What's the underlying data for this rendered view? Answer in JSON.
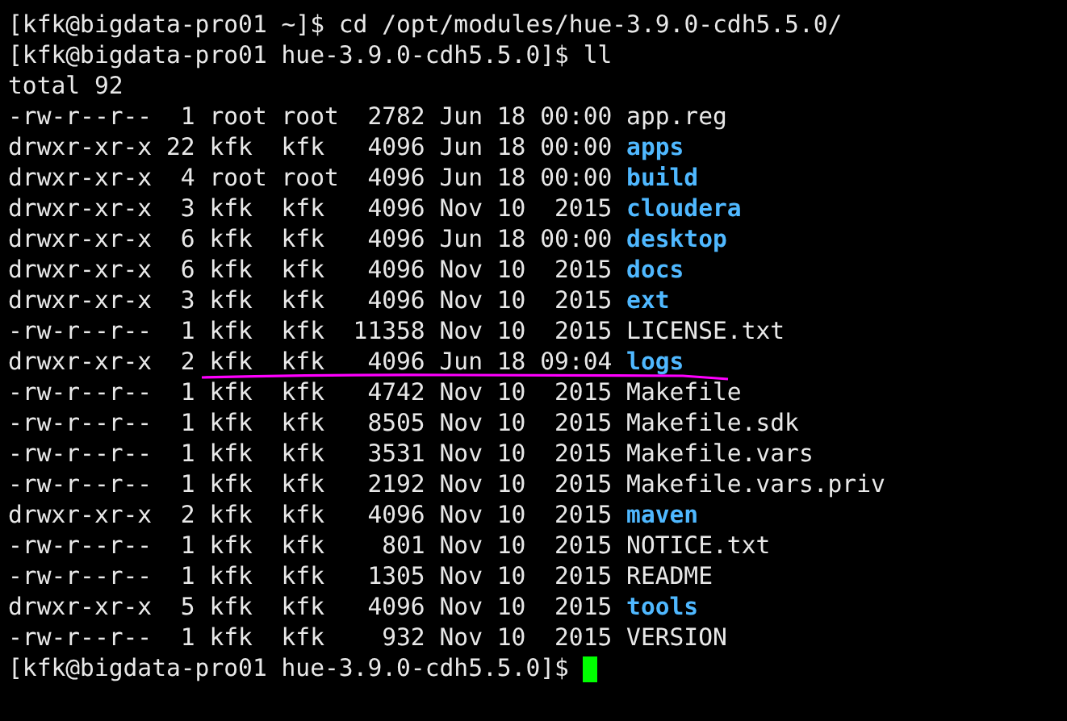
{
  "terminal": {
    "lines": [
      {
        "kind": "command",
        "prompt": "[kfk@bigdata-pro01 ~]$",
        "command": "cd /opt/modules/hue-3.9.0-cdh5.5.0/"
      },
      {
        "kind": "command",
        "prompt": "[kfk@bigdata-pro01 hue-3.9.0-cdh5.5.0]$",
        "command": "ll"
      },
      {
        "kind": "output",
        "text": "total 92"
      },
      {
        "kind": "file",
        "info": "-rw-r--r--  1 root root  2782 Jun 18 00:00",
        "name": "app.reg"
      },
      {
        "kind": "dir",
        "info": "drwxr-xr-x 22 kfk  kfk   4096 Jun 18 00:00",
        "name": "apps"
      },
      {
        "kind": "dir",
        "info": "drwxr-xr-x  4 root root  4096 Jun 18 00:00",
        "name": "build"
      },
      {
        "kind": "dir",
        "info": "drwxr-xr-x  3 kfk  kfk   4096 Nov 10  2015",
        "name": "cloudera"
      },
      {
        "kind": "dir",
        "info": "drwxr-xr-x  6 kfk  kfk   4096 Jun 18 00:00",
        "name": "desktop"
      },
      {
        "kind": "dir",
        "info": "drwxr-xr-x  6 kfk  kfk   4096 Nov 10  2015",
        "name": "docs"
      },
      {
        "kind": "dir",
        "info": "drwxr-xr-x  3 kfk  kfk   4096 Nov 10  2015",
        "name": "ext"
      },
      {
        "kind": "file",
        "info": "-rw-r--r--  1 kfk  kfk  11358 Nov 10  2015",
        "name": "LICENSE.txt"
      },
      {
        "kind": "dir",
        "info": "drwxr-xr-x  2 kfk  kfk   4096 Jun 18 09:04",
        "name": "logs",
        "underlined": true
      },
      {
        "kind": "file",
        "info": "-rw-r--r--  1 kfk  kfk   4742 Nov 10  2015",
        "name": "Makefile"
      },
      {
        "kind": "file",
        "info": "-rw-r--r--  1 kfk  kfk   8505 Nov 10  2015",
        "name": "Makefile.sdk"
      },
      {
        "kind": "file",
        "info": "-rw-r--r--  1 kfk  kfk   3531 Nov 10  2015",
        "name": "Makefile.vars"
      },
      {
        "kind": "file",
        "info": "-rw-r--r--  1 kfk  kfk   2192 Nov 10  2015",
        "name": "Makefile.vars.priv"
      },
      {
        "kind": "dir",
        "info": "drwxr-xr-x  2 kfk  kfk   4096 Nov 10  2015",
        "name": "maven"
      },
      {
        "kind": "file",
        "info": "-rw-r--r--  1 kfk  kfk    801 Nov 10  2015",
        "name": "NOTICE.txt"
      },
      {
        "kind": "file",
        "info": "-rw-r--r--  1 kfk  kfk   1305 Nov 10  2015",
        "name": "README"
      },
      {
        "kind": "dir",
        "info": "drwxr-xr-x  5 kfk  kfk   4096 Nov 10  2015",
        "name": "tools"
      },
      {
        "kind": "file",
        "info": "-rw-r--r--  1 kfk  kfk    932 Nov 10  2015",
        "name": "VERSION"
      },
      {
        "kind": "command",
        "prompt": "[kfk@bigdata-pro01 hue-3.9.0-cdh5.5.0]$",
        "cursor": true
      }
    ]
  }
}
